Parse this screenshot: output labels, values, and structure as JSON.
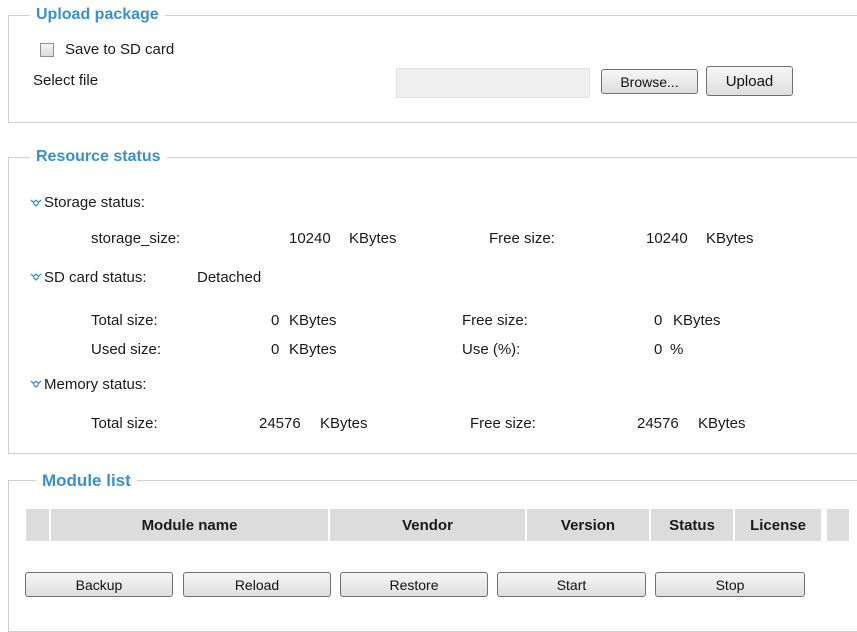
{
  "upload": {
    "title": "Upload package",
    "save_to_sd_label": "Save to SD card",
    "select_file_label": "Select file",
    "browse_label": "Browse...",
    "upload_label": "Upload"
  },
  "resource": {
    "title": "Resource status",
    "storage": {
      "heading": "Storage status:",
      "size_label": "storage_size:",
      "size_value": "10240",
      "size_unit": "KBytes",
      "free_label": "Free size:",
      "free_value": "10240",
      "free_unit": "KBytes"
    },
    "sd": {
      "heading": "SD card status:",
      "state": "Detached",
      "total_label": "Total size:",
      "total_value": "0",
      "total_unit": "KBytes",
      "free_label": "Free size:",
      "free_value": "0",
      "free_unit": "KBytes",
      "used_label": "Used size:",
      "used_value": "0",
      "used_unit": "KBytes",
      "use_label": "Use (%):",
      "use_value": "0",
      "use_unit": "%"
    },
    "memory": {
      "heading": "Memory status:",
      "total_label": "Total size:",
      "total_value": "24576",
      "total_unit": "KBytes",
      "free_label": "Free size:",
      "free_value": "24576",
      "free_unit": "KBytes"
    }
  },
  "modules": {
    "title": "Module list",
    "columns": [
      "Module name",
      "Vendor",
      "Version",
      "Status",
      "License"
    ],
    "buttons": [
      "Backup",
      "Reload",
      "Restore",
      "Start",
      "Stop"
    ]
  },
  "colors": {
    "accent": "#3b8fd0",
    "header_bg": "#dcdcdc",
    "border": "#cfcfcf"
  },
  "icons": {
    "section_bullet": "double-chevron-down-icon"
  }
}
